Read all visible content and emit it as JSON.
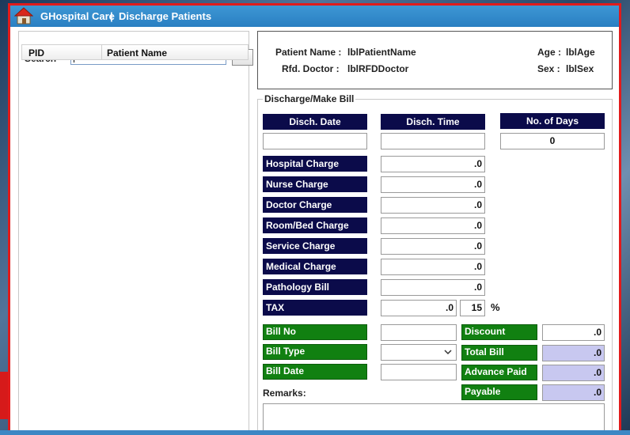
{
  "window": {
    "app_title": "GHospital Care",
    "separator": "|",
    "page_title": "Discharge Patients"
  },
  "left": {
    "search_label": "Search",
    "search_value": "",
    "browse_label": "...",
    "columns": [
      "PID",
      "Patient Name"
    ]
  },
  "patient": {
    "name_label": "Patient Name :",
    "name_value": "lblPatientName",
    "doctor_label": "Rfd. Doctor :",
    "doctor_value": "lblRFDDoctor",
    "age_label": "Age :",
    "age_value": "lblAge",
    "sex_label": "Sex :",
    "sex_value": "lblSex"
  },
  "bill": {
    "group_title": "Discharge/Make Bill",
    "disch_date_label": "Disch. Date",
    "disch_time_label": "Disch. Time",
    "days_label": "No. of Days",
    "disch_date_value": "",
    "disch_time_value": "",
    "days_value": "0",
    "charges": [
      {
        "label": "Hospital Charge",
        "value": ".0"
      },
      {
        "label": "Nurse Charge",
        "value": ".0"
      },
      {
        "label": "Doctor  Charge",
        "value": ".0"
      },
      {
        "label": "Room/Bed Charge",
        "value": ".0"
      },
      {
        "label": "Service Charge",
        "value": ".0"
      },
      {
        "label": "Medical Charge",
        "value": ".0"
      },
      {
        "label": "Pathology Bill",
        "value": ".0"
      }
    ],
    "tax_label": "TAX",
    "tax_value": ".0",
    "tax_rate": "15",
    "tax_unit": "%",
    "bill_no_label": "Bill No",
    "bill_type_label": "Bill Type",
    "bill_date_label": "Bill Date",
    "bill_no_value": "",
    "bill_type_value": "",
    "bill_date_value": "",
    "discount_label": "Discount",
    "discount_value": ".0",
    "total_label": "Total Bill",
    "total_value": ".0",
    "advance_label": "Advance Paid",
    "advance_value": ".0",
    "payable_label": "Payable",
    "payable_value": ".0",
    "remarks_label": "Remarks:",
    "remarks_value": ""
  },
  "colors": {
    "window_border": "#e11b1b",
    "titlebar": "#2a7fc2",
    "label_navy": "#0b0b4a",
    "label_green": "#118011",
    "readonly_field": "#c8c8f0"
  },
  "icons": {
    "home": "home-icon",
    "dropdown": "chevron-down-icon"
  }
}
